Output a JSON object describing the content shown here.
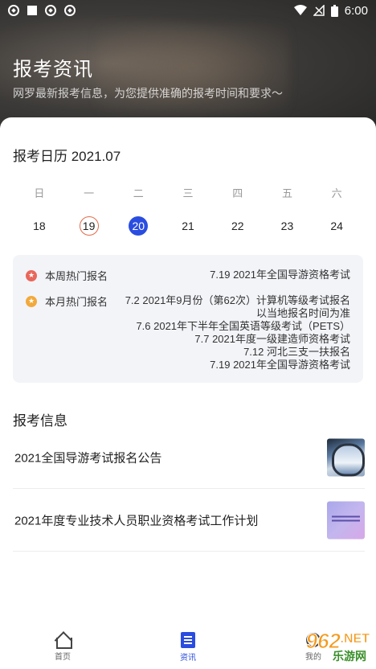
{
  "status_bar": {
    "time": "6:00"
  },
  "header": {
    "title": "报考资讯",
    "subtitle": "网罗最新报考信息，为您提供准确的报考时间和要求～"
  },
  "calendar": {
    "title": "报考日历 2021.07",
    "weekdays": [
      "日",
      "一",
      "二",
      "三",
      "四",
      "五",
      "六"
    ],
    "dates": [
      "18",
      "19",
      "20",
      "21",
      "22",
      "23",
      "24"
    ],
    "today": "19",
    "selected": "20"
  },
  "hot": {
    "week": {
      "label": "本周热门报名",
      "items": [
        "7.19 2021年全国导游资格考试"
      ]
    },
    "month": {
      "label": "本月热门报名",
      "items": [
        "7.2 2021年9月份（第62次）计算机等级考试报名",
        "以当地报名时间为准",
        "7.6 2021年下半年全国英语等级考试（PETS）",
        "7.7 2021年度一级建造师资格考试",
        "7.12 河北三支一扶报名",
        "7.19 2021年全国导游资格考试"
      ]
    }
  },
  "info": {
    "title": "报考信息",
    "items": [
      {
        "title": "2021全国导游考试报名公告"
      },
      {
        "title": "2021年度专业技术人员职业资格考试工作计划"
      }
    ]
  },
  "tabbar": {
    "tabs": [
      {
        "label": "首页"
      },
      {
        "label": "资讯"
      },
      {
        "label": "我的"
      }
    ],
    "active_color": "#2a4de0"
  },
  "watermark": {
    "number": "962",
    "suffix": ".NET",
    "site": "乐游网"
  },
  "colors": {
    "selected_date": "#2a4de0",
    "today_ring": "#e26a4a",
    "hot_week_dot": "#e9675a",
    "hot_month_dot": "#f2a93b"
  }
}
